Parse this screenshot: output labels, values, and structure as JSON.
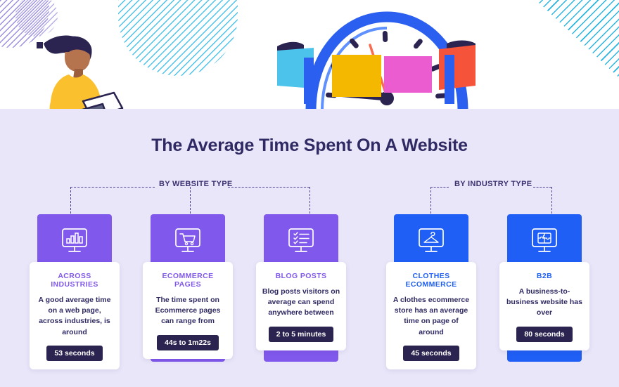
{
  "page": {
    "title": "The Average Time Spent On A Website",
    "bg_color": "#e9e6f9",
    "hero_bg": "#ffffff",
    "purple": "#8158ec",
    "blue": "#1f5ff5",
    "dark": "#2b2450"
  },
  "sections": [
    {
      "label": "BY WEBSITE TYPE"
    },
    {
      "label": "BY INDUSTRY TYPE"
    }
  ],
  "cards": [
    {
      "icon": "monitor-bar-chart-icon",
      "kicker": "ACROSS INDUSTRIES",
      "desc": "A good average time on a web page, across industries, is around",
      "value": "53 seconds",
      "accent": "#8158ec"
    },
    {
      "icon": "monitor-shopping-cart-icon",
      "kicker": "ECOMMERCE PAGES",
      "desc": "The time spent on Ecommerce pages can range from",
      "value": "44s to 1m22s",
      "accent": "#8158ec"
    },
    {
      "icon": "monitor-checklist-icon",
      "kicker": "BLOG POSTS",
      "desc": "Blog posts visitors on average can spend anywhere between",
      "value": "2 to 5 minutes",
      "accent": "#8158ec"
    },
    {
      "icon": "monitor-clothes-hanger-icon",
      "kicker": "CLOTHES ECOMMERCE",
      "desc": "A clothes ecommerce store has an average time on page of around",
      "value": "45 seconds",
      "accent": "#1f5ff5"
    },
    {
      "icon": "monitor-puzzle-icon",
      "kicker": "B2B",
      "desc": "A business-to-business website has over",
      "value": "80 seconds",
      "accent": "#1f5ff5"
    }
  ],
  "illustration": {
    "woman": "woman-sitting-with-laptop-illustration",
    "clock": "clock-with-colored-banners-illustration",
    "clock_banner_colors": [
      "#4cc3ea",
      "#f5b800",
      "#ea5cd0",
      "#f5543b"
    ],
    "clock_ring_color": "#2a5ff0",
    "decorations": [
      "striped-circle-purple-decoration",
      "striped-blob-cyan-decoration",
      "striped-corner-cyan-decoration",
      "dark-square-decoration"
    ]
  }
}
